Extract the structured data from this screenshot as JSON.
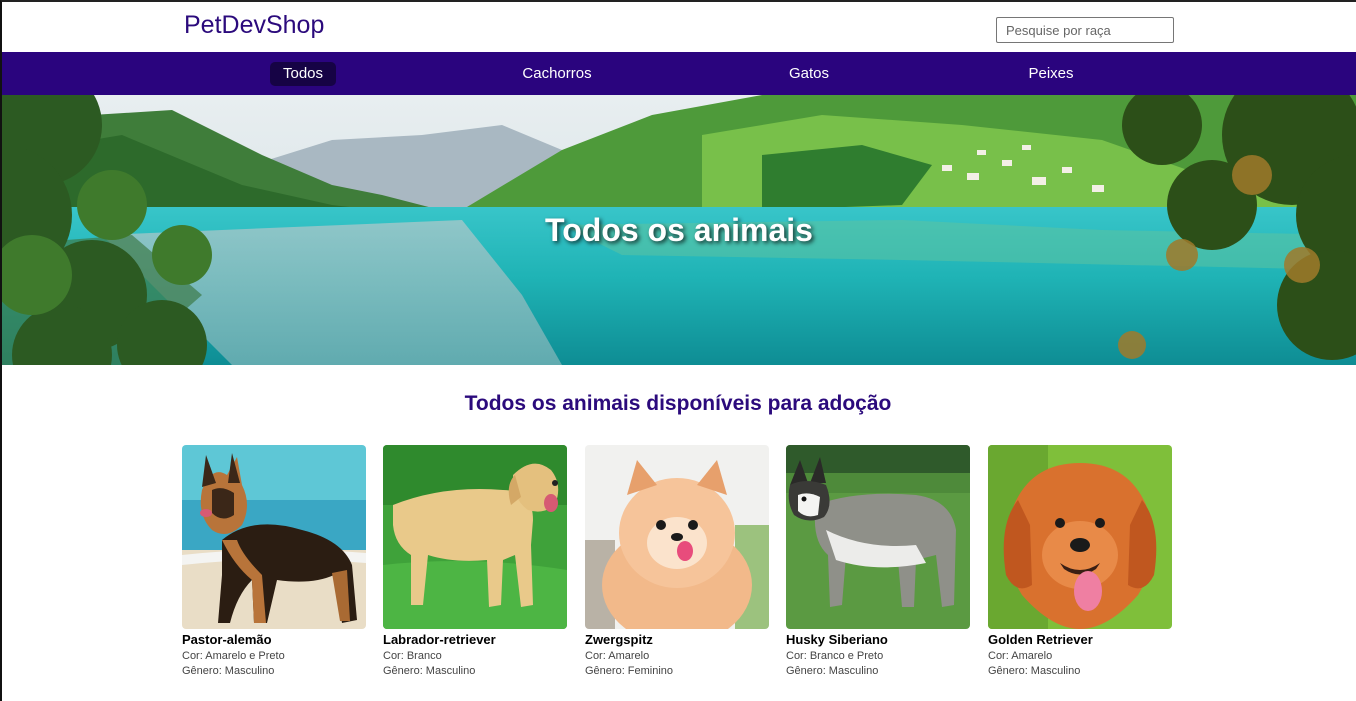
{
  "header": {
    "logo": "PetDevShop",
    "search_placeholder": "Pesquise por raça"
  },
  "nav": {
    "items": [
      {
        "label": "Todos",
        "active": true
      },
      {
        "label": "Cachorros",
        "active": false
      },
      {
        "label": "Gatos",
        "active": false
      },
      {
        "label": "Peixes",
        "active": false
      }
    ]
  },
  "hero": {
    "title": "Todos os animais"
  },
  "section": {
    "title": "Todos os animais disponíveis para adoção"
  },
  "animals": [
    {
      "name": "Pastor-alemão",
      "color_line": "Cor: Amarelo e Preto",
      "gender_line": "Gênero: Masculino"
    },
    {
      "name": "Labrador-retriever",
      "color_line": "Cor: Branco",
      "gender_line": "Gênero: Masculino"
    },
    {
      "name": "Zwergspitz",
      "color_line": "Cor: Amarelo",
      "gender_line": "Gênero: Feminino"
    },
    {
      "name": "Husky Siberiano",
      "color_line": "Cor: Branco e Preto",
      "gender_line": "Gênero: Masculino"
    },
    {
      "name": "Golden Retriever",
      "color_line": "Cor: Amarelo",
      "gender_line": "Gênero: Masculino"
    }
  ],
  "colors": {
    "brand": "#2b0a7c",
    "nav_bg": "#2a047e",
    "nav_active": "#160345"
  }
}
